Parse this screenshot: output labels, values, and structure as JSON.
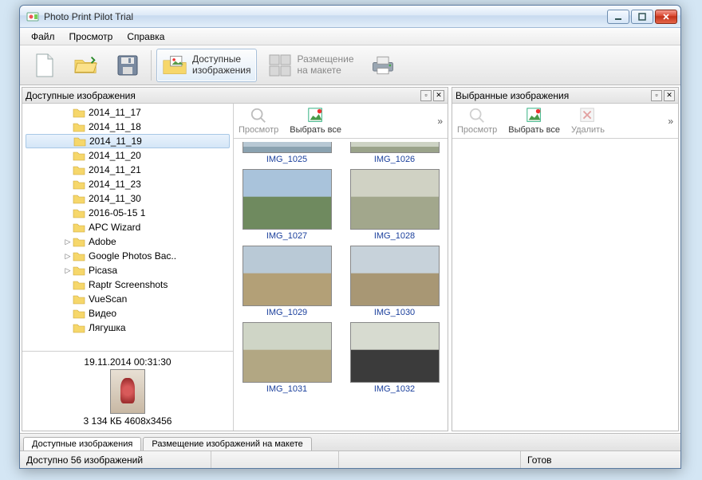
{
  "window": {
    "title": "Photo Print Pilot Trial"
  },
  "menubar": [
    "Файл",
    "Просмотр",
    "Справка"
  ],
  "toolbar": {
    "new": "",
    "open": "",
    "save": "",
    "available": "Доступные\nизображения",
    "layout": "Размещение\nна макете"
  },
  "panels": {
    "left_title": "Доступные изображения",
    "right_title": "Выбранные изображения",
    "pin_tip": "pin",
    "close_tip": "close"
  },
  "tree": {
    "items": [
      {
        "label": "2014_11_17",
        "exp": ""
      },
      {
        "label": "2014_11_18",
        "exp": ""
      },
      {
        "label": "2014_11_19",
        "exp": "",
        "selected": true
      },
      {
        "label": "2014_11_20",
        "exp": ""
      },
      {
        "label": "2014_11_21",
        "exp": ""
      },
      {
        "label": "2014_11_23",
        "exp": ""
      },
      {
        "label": "2014_11_30",
        "exp": ""
      },
      {
        "label": "2016-05-15 1",
        "exp": ""
      },
      {
        "label": "APC Wizard",
        "exp": ""
      },
      {
        "label": "Adobe",
        "exp": "▷"
      },
      {
        "label": "Google Photos Bac..",
        "exp": "▷"
      },
      {
        "label": "Picasa",
        "exp": "▷"
      },
      {
        "label": "Raptr Screenshots",
        "exp": ""
      },
      {
        "label": "VueScan",
        "exp": ""
      },
      {
        "label": "Видео",
        "exp": ""
      },
      {
        "label": "Лягушка",
        "exp": ""
      }
    ]
  },
  "preview": {
    "date": "19.11.2014 00:31:30",
    "info": "3 134 КБ 4608x3456"
  },
  "thumbs_toolbar": {
    "view": "Просмотр",
    "select_all": "Выбрать все",
    "delete": "Удалить",
    "expand": "»"
  },
  "thumbs": [
    {
      "label": "IMG_1025",
      "c1": "#b7c8d4",
      "c2": "#8aa2b0"
    },
    {
      "label": "IMG_1026",
      "c1": "#cdd3c4",
      "c2": "#9aa38a"
    },
    {
      "label": "IMG_1027",
      "c1": "#a9c3db",
      "c2": "#6f8a5f"
    },
    {
      "label": "IMG_1028",
      "c1": "#d0d2c4",
      "c2": "#a2a78c"
    },
    {
      "label": "IMG_1029",
      "c1": "#b9c9d6",
      "c2": "#b3a077"
    },
    {
      "label": "IMG_1030",
      "c1": "#c7d2da",
      "c2": "#a89774"
    },
    {
      "label": "IMG_1031",
      "c1": "#cfd5c6",
      "c2": "#b2a783"
    },
    {
      "label": "IMG_1032",
      "c1": "#d7dbd0",
      "c2": "#3b3b3b"
    }
  ],
  "bottom_tabs": {
    "available": "Доступные изображения",
    "layout": "Размещение изображений на макете"
  },
  "status": {
    "left": "Доступно 56 изображений",
    "right": "Готов"
  }
}
